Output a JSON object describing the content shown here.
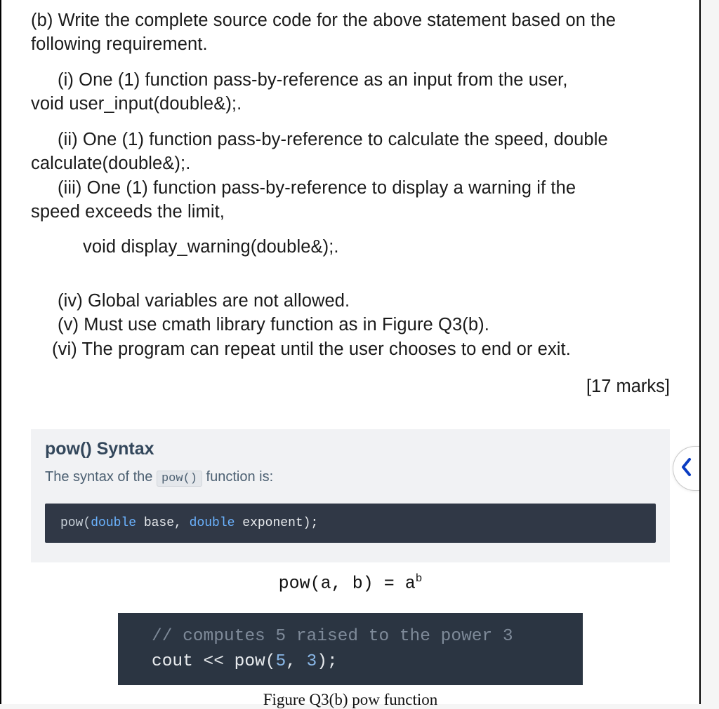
{
  "question": {
    "part_b": "(b) Write the complete source code for the above statement based on the following requirement.",
    "i_line1": "(i) One (1) function pass-by-reference as an input from the user,",
    "i_line2": "void user_input(double&);.",
    "ii_line1": "(ii) One (1) function pass-by-reference to calculate the speed, double",
    "ii_line2": "calculate(double&);.",
    "iii_line1": "(iii) One (1) function pass-by-reference to display a warning if the",
    "iii_line2": "speed exceeds the limit,",
    "iii_line3": "void  display_warning(double&);.",
    "iv": "(iv) Global variables are not allowed.",
    "v": "(v) Must use cmath library function as in Figure Q3(b).",
    "vi": "(vi) The program can repeat until the user chooses to end or exit.",
    "marks": "[17 marks]"
  },
  "syntax": {
    "title": "pow() Syntax",
    "desc_prefix": "The syntax of the ",
    "desc_code": "pow()",
    "desc_suffix": " function is:",
    "code_pow": "pow(",
    "code_type1": "double",
    "code_base": " base, ",
    "code_type2": "double",
    "code_exp": " exponent);"
  },
  "formula": {
    "left": "pow(a, b)  = a",
    "sup": "b"
  },
  "example": {
    "comment": "// computes 5 raised to the power 3",
    "line_prefix": "cout << pow(",
    "n1": "5",
    "comma": ", ",
    "n2": "3",
    "suffix": ");"
  },
  "caption": "Figure Q3(b) pow function",
  "icons": {
    "chevron_left": "chevron-left-icon"
  }
}
